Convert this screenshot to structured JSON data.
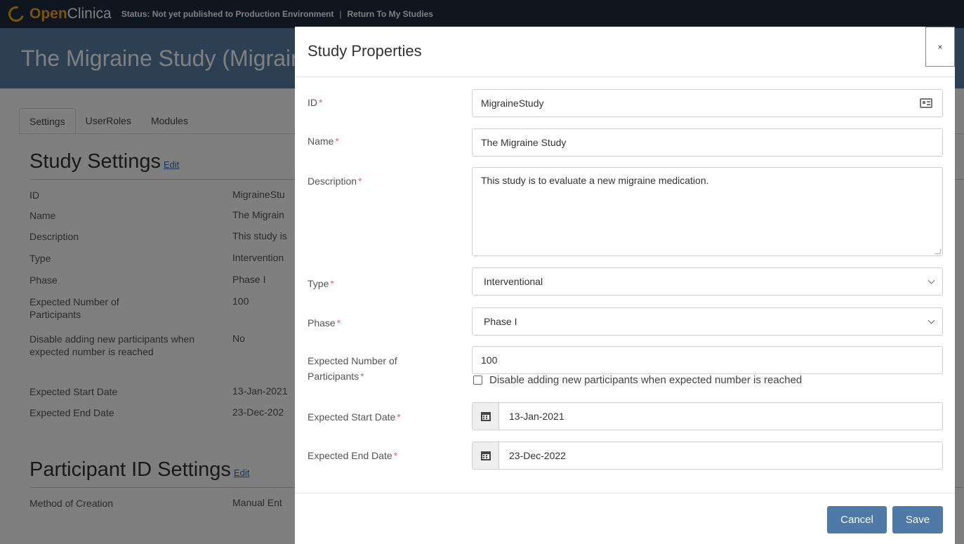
{
  "topbar": {
    "brand_open": "Open",
    "brand_clinica": "Clinica",
    "status": "Status: Not yet published to Production Environment",
    "separator": "|",
    "return_link": "Return To My Studies"
  },
  "header": {
    "study_title": "The  Migraine Study (Migraine"
  },
  "tabs": [
    {
      "label": "Settings"
    },
    {
      "label": "UserRoles"
    },
    {
      "label": "Modules"
    }
  ],
  "study_settings": {
    "title": "Study Settings",
    "edit": "Edit",
    "rows": [
      {
        "label": "ID",
        "value": "MigraineStu"
      },
      {
        "label": "Name",
        "value": "The Migrain"
      },
      {
        "label": "Description",
        "value": "This study is"
      },
      {
        "label": "Type",
        "value": "Intervention"
      },
      {
        "label": "Phase",
        "value": "Phase I"
      },
      {
        "label": "Expected Number of Participants",
        "value": "100"
      },
      {
        "label": "Disable adding new participants when expected number is reached",
        "value": "No"
      },
      {
        "label": "Expected Start Date",
        "value": "13-Jan-2021"
      },
      {
        "label": "Expected End Date",
        "value": "23-Dec-202"
      }
    ]
  },
  "participant_settings": {
    "title": "Participant ID Settings",
    "edit": "Edit",
    "rows": [
      {
        "label": "Method of Creation",
        "value": "Manual Ent"
      }
    ]
  },
  "modal": {
    "title": "Study Properties",
    "close": "×",
    "required_mark": "*",
    "fields": {
      "id": {
        "label": "ID",
        "value": "MigraineStudy"
      },
      "name": {
        "label": "Name",
        "value": "The Migraine Study"
      },
      "description": {
        "label": "Description",
        "value": "This study is to evaluate a new migraine medication."
      },
      "type": {
        "label": "Type",
        "value": "Interventional"
      },
      "phase": {
        "label": "Phase",
        "value": "Phase I"
      },
      "expected_number": {
        "label_line1": "Expected Number of",
        "label_line2": "Participants",
        "value": "100",
        "checkbox_label": "Disable adding new participants when expected number is reached",
        "checked": false
      },
      "start_date": {
        "label": "Expected Start Date",
        "value": "13-Jan-2021"
      },
      "end_date": {
        "label": "Expected End Date",
        "value": "23-Dec-2022"
      }
    },
    "cancel_label": "Cancel",
    "save_label": "Save"
  },
  "colors": {
    "topbar": "#1f2d3f",
    "header": "#5a7fa6",
    "brand_accent": "#f5a623",
    "button": "#4f79a6",
    "required": "#e06565"
  },
  "icons": [
    "openclinica-logo-icon",
    "id-card-icon",
    "chevron-down-icon",
    "calendar-icon",
    "close-icon"
  ]
}
